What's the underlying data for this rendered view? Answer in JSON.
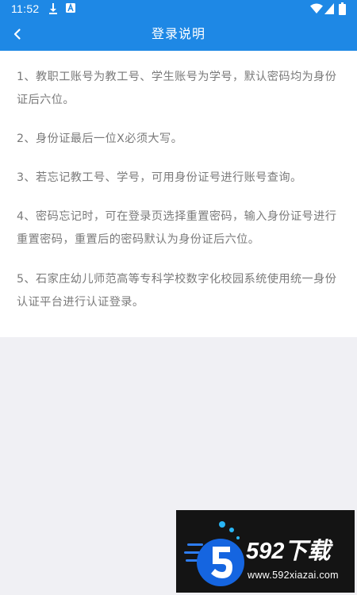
{
  "status_bar": {
    "time": "11:52",
    "icons": [
      "download-icon",
      "a-notification-icon",
      "wifi-icon",
      "signal-icon",
      "battery-icon"
    ]
  },
  "app_bar": {
    "title": "登录说明",
    "back_icon": "chevron-left-icon",
    "color": "#1e88e5"
  },
  "instructions": [
    "1、教职工账号为教工号、学生账号为学号，默认密码均为身份证后六位。",
    "2、身份证最后一位X必须大写。",
    "3、若忘记教工号、学号，可用身份证号进行账号查询。",
    "4、密码忘记时，可在登录页选择重置密码，输入身份证号进行重置密码，重置后的密码默认为身份证后六位。",
    "5、石家庄幼儿师范高等专科学校数字化校园系统使用统一身份认证平台进行认证登录。"
  ],
  "watermark": {
    "brand": "592下载",
    "url": "www.592xiazai.com"
  }
}
